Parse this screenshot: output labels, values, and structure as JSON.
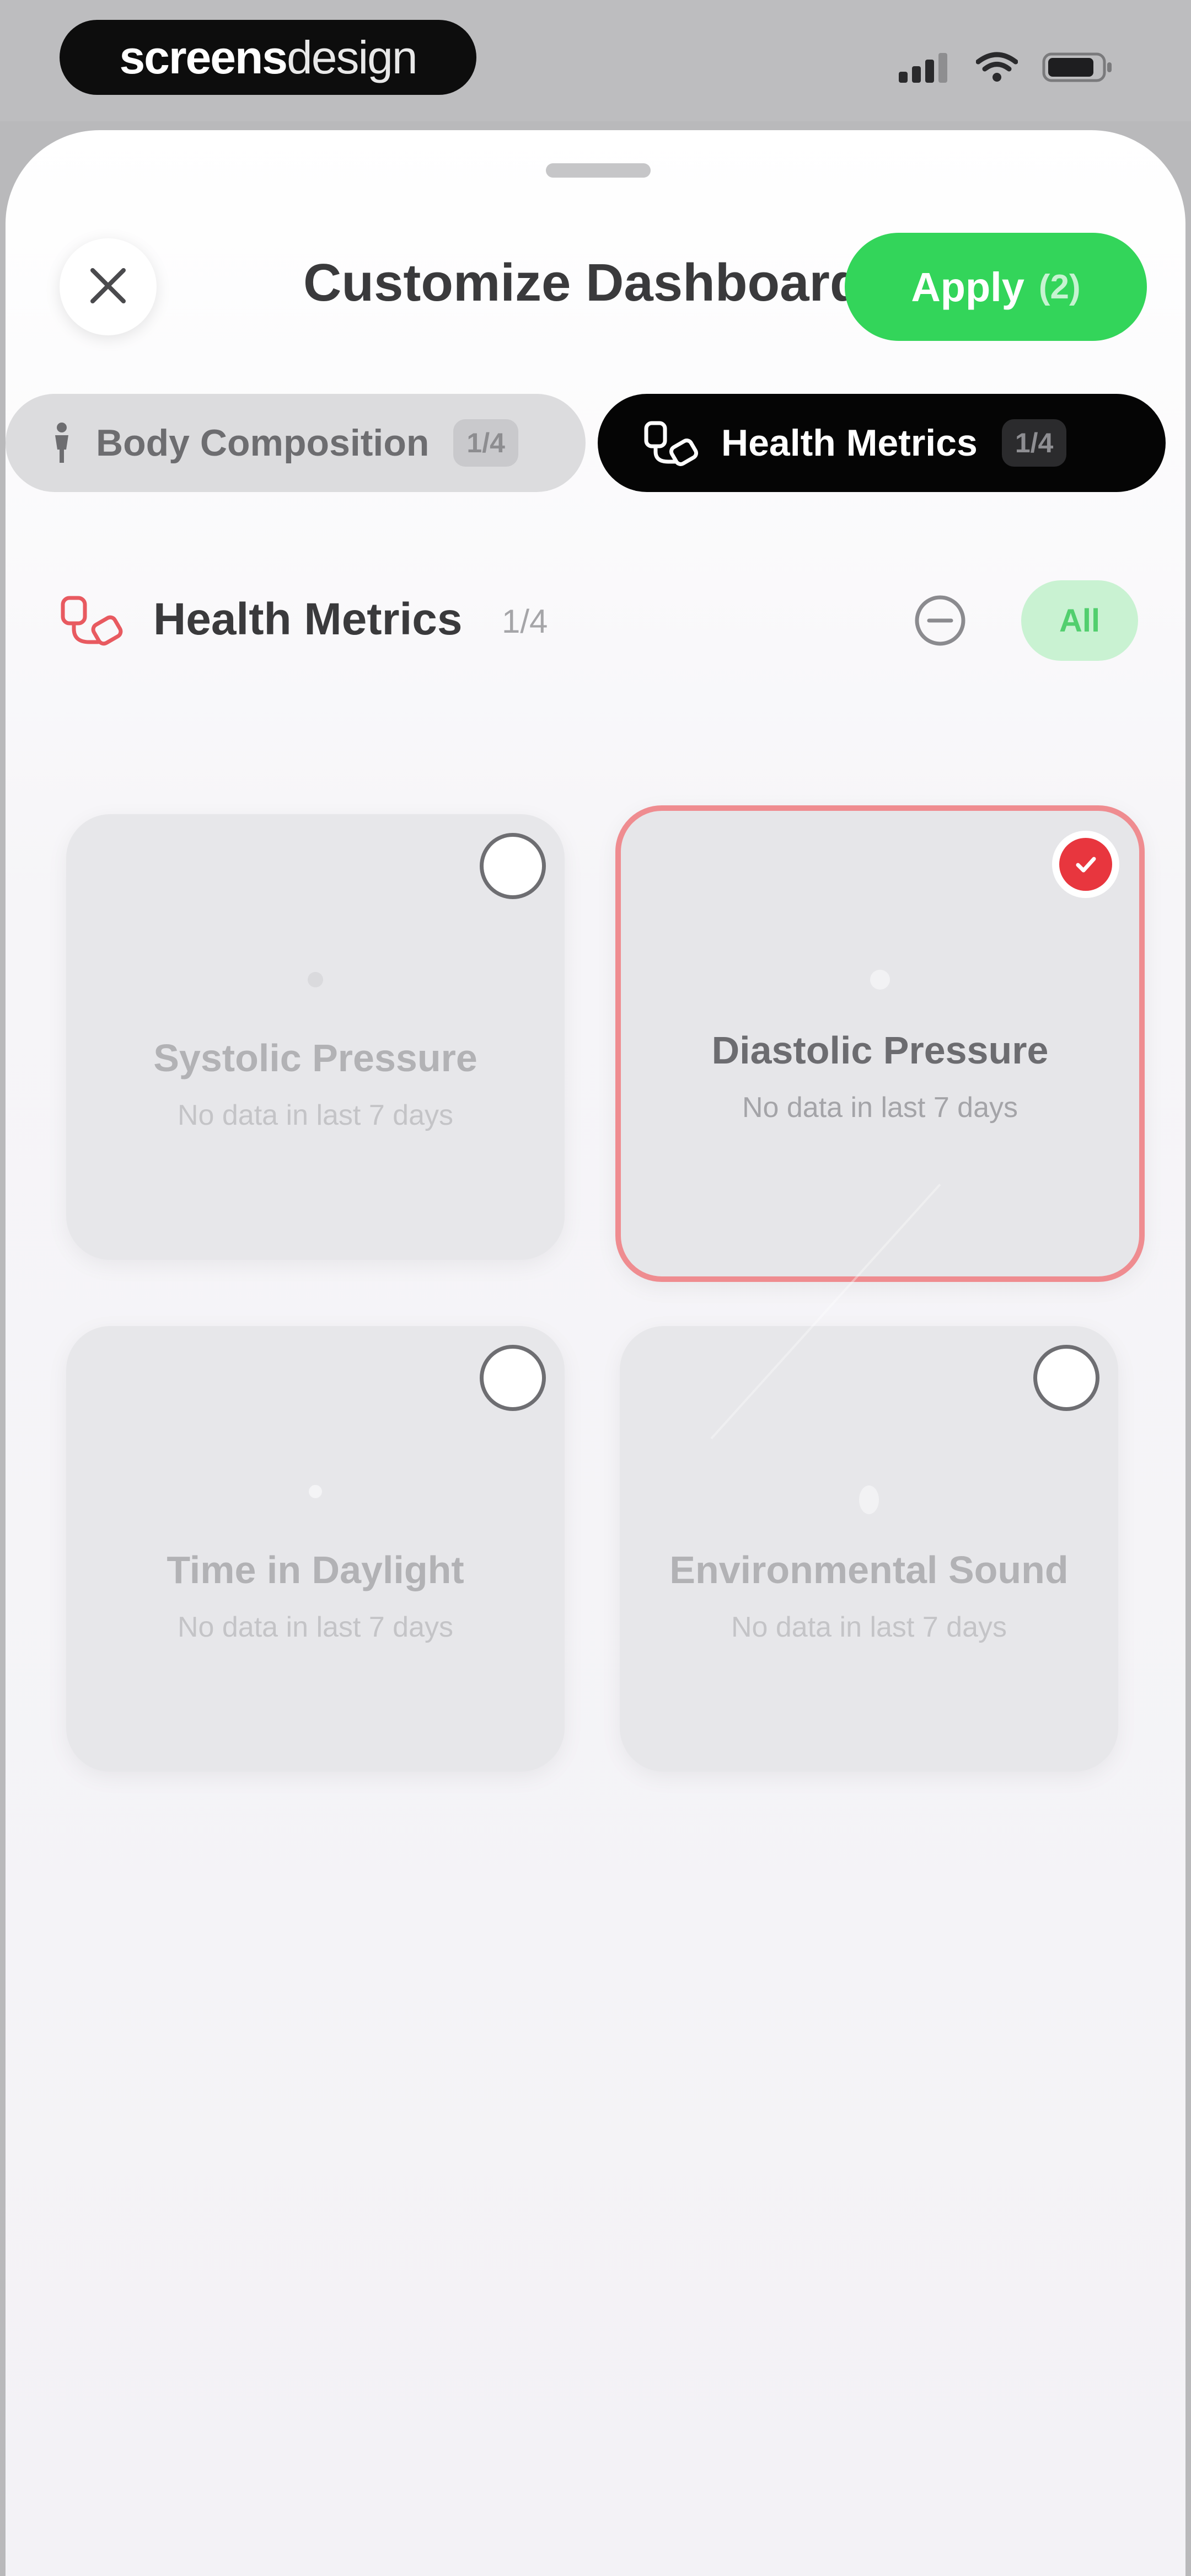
{
  "status_bar": {
    "watermark_bold": "screens",
    "watermark_light": "design",
    "icons": [
      "signal-icon",
      "wifi-icon",
      "battery-icon"
    ]
  },
  "sheet": {
    "title": "Customize Dashboard",
    "apply_label": "Apply",
    "apply_count": "(2)"
  },
  "tabs": [
    {
      "label": "Body Composition",
      "badge": "1/4",
      "icon": "person-icon",
      "active": false
    },
    {
      "label": "Health Metrics",
      "badge": "1/4",
      "icon": "stethoscope-icon",
      "active": true
    }
  ],
  "section": {
    "title": "Health Metrics",
    "count": "1/4",
    "all_label": "All"
  },
  "cards": [
    {
      "title": "Systolic Pressure",
      "subtitle": "No data in last 7 days",
      "selected": false
    },
    {
      "title": "Diastolic Pressure",
      "subtitle": "No data in last 7 days",
      "selected": true
    },
    {
      "title": "Time in Daylight",
      "subtitle": "No data in last 7 days",
      "selected": false
    },
    {
      "title": "Environmental Sound",
      "subtitle": "No data in last 7 days",
      "selected": false
    }
  ],
  "colors": {
    "accent_green": "#33d55a",
    "selected_red": "#e8363e",
    "tab_active_bg": "#050505"
  }
}
